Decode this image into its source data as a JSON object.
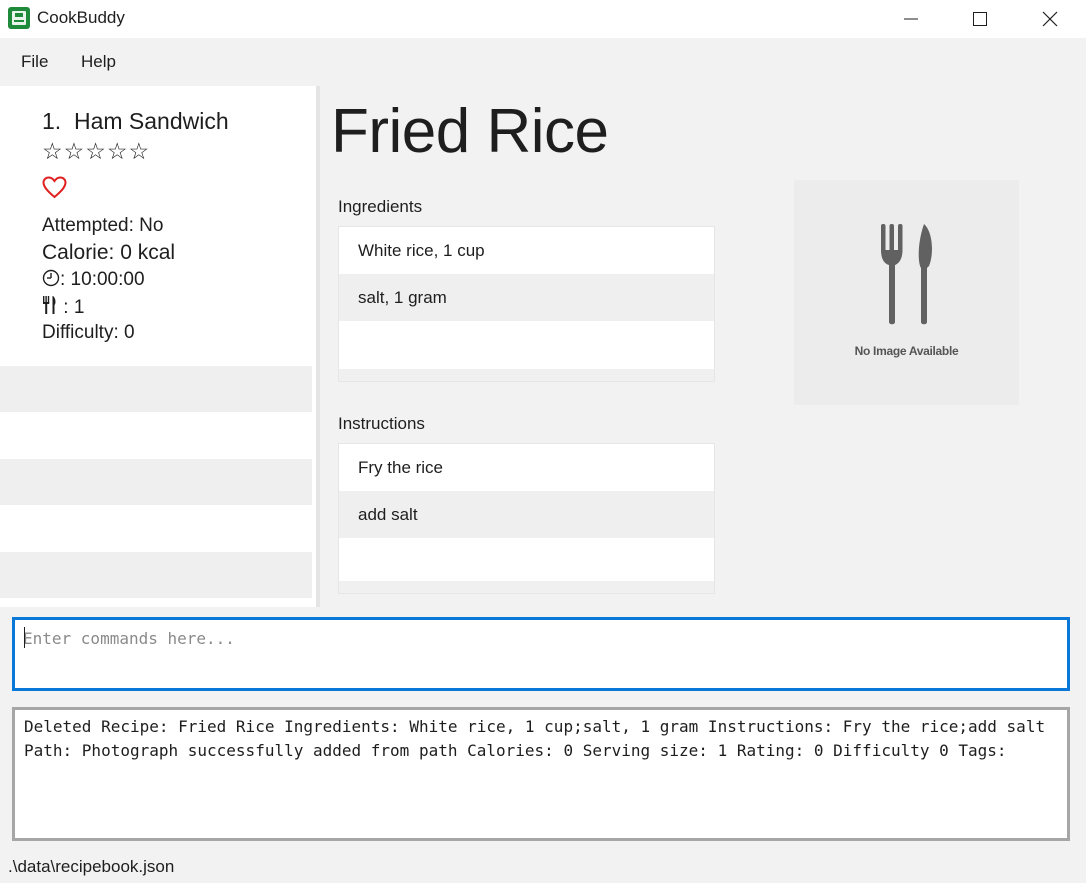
{
  "window": {
    "title": "CookBuddy",
    "controls": {
      "minimize": "minimize-icon",
      "maximize": "maximize-icon",
      "close": "close-icon"
    }
  },
  "menu": {
    "items": [
      {
        "label": "File"
      },
      {
        "label": "Help"
      }
    ]
  },
  "recipe_list": {
    "cards": [
      {
        "index": "1.",
        "name": "Ham Sandwich",
        "stars": "☆☆☆☆☆",
        "favourite_icon": "heart-outline-icon",
        "attempted": "Attempted: No",
        "calorie": "Calorie: 0 kcal",
        "time": ": 10:00:00",
        "servings": " : 1",
        "difficulty": "Difficulty: 0"
      }
    ]
  },
  "detail": {
    "title": "Fried Rice",
    "ingredients_label": "Ingredients",
    "ingredients": [
      "White rice, 1 cup",
      "salt, 1 gram"
    ],
    "instructions_label": "Instructions",
    "instructions": [
      "Fry the rice",
      "add salt"
    ],
    "image_placeholder_text": "No Image Available"
  },
  "command": {
    "placeholder": "Enter commands here...",
    "value": ""
  },
  "result": {
    "text": "Deleted Recipe: Fried Rice Ingredients: White rice, 1 cup;salt, 1 gram Instructions: Fry the rice;add salt Path: Photograph successfully added from path Calories: 0 Serving size: 1 Rating: 0 Difficulty 0 Tags:"
  },
  "status": {
    "file_path": ".\\data\\recipebook.json"
  },
  "colors": {
    "accent": "#0a78d7",
    "heart": "#e02020",
    "app_icon": "#1f8a3a"
  }
}
